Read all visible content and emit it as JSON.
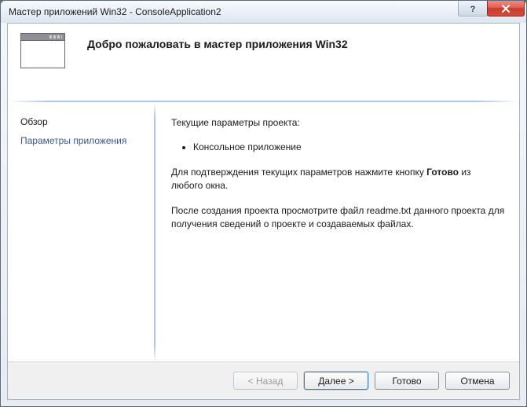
{
  "window": {
    "title": "Мастер приложений Win32 - ConsoleApplication2"
  },
  "header": {
    "heading": "Добро пожаловать в мастер приложения Win32"
  },
  "sidebar": {
    "items": [
      {
        "label": "Обзор",
        "active": true
      },
      {
        "label": "Параметры приложения",
        "active": false
      }
    ]
  },
  "content": {
    "current_settings_label": "Текущие параметры проекта:",
    "bullets": [
      "Консольное приложение"
    ],
    "confirm_line_prefix": "Для подтверждения текущих параметров нажмите кнопку ",
    "confirm_line_bold": "Готово",
    "confirm_line_suffix": " из любого окна.",
    "readme_line": "После создания проекта просмотрите файл readme.txt данного проекта для получения сведений о проекте и создаваемых файлах."
  },
  "buttons": {
    "back": "< Назад",
    "next": "Далее >",
    "finish": "Готово",
    "cancel": "Отмена"
  }
}
